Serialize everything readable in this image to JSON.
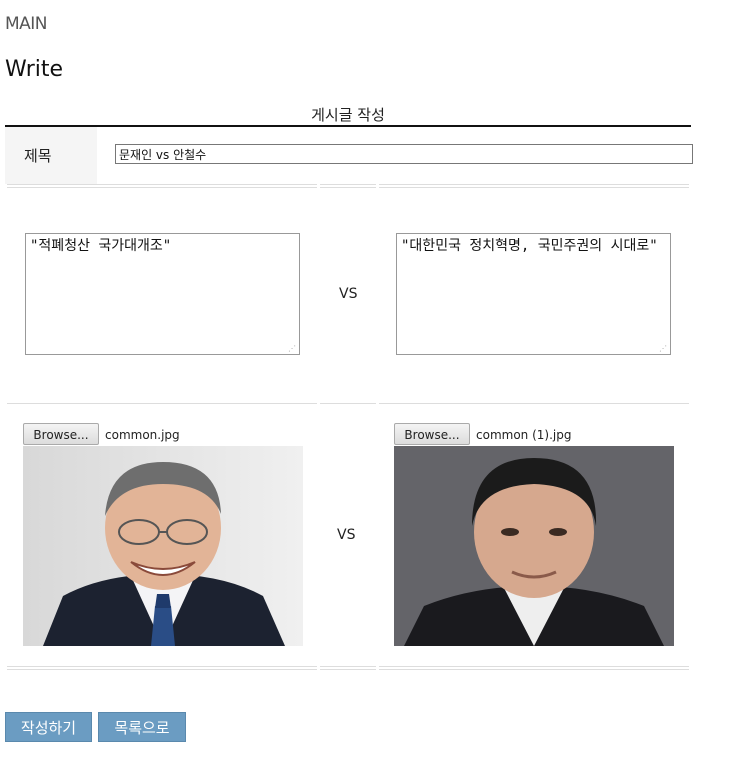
{
  "nav": {
    "main_label": "MAIN"
  },
  "page": {
    "title": "Write"
  },
  "form": {
    "caption": "게시글 작성",
    "title_label": "제목",
    "title_value": "문재인 vs 안철수",
    "left_text": "\"적폐청산 국가대개조\"",
    "right_text": "\"대한민국 정치혁명, 국민주권의 시대로\"",
    "vs_label": "VS",
    "left_file": {
      "button_label": "Browse...",
      "file_name": "common.jpg"
    },
    "right_file": {
      "button_label": "Browse...",
      "file_name": "common (1).jpg"
    }
  },
  "actions": {
    "submit_label": "작성하기",
    "list_label": "목록으로"
  },
  "colors": {
    "button_bg": "#6b9cc2",
    "caption_rule": "#111111",
    "label_bg": "#f5f5f5"
  }
}
